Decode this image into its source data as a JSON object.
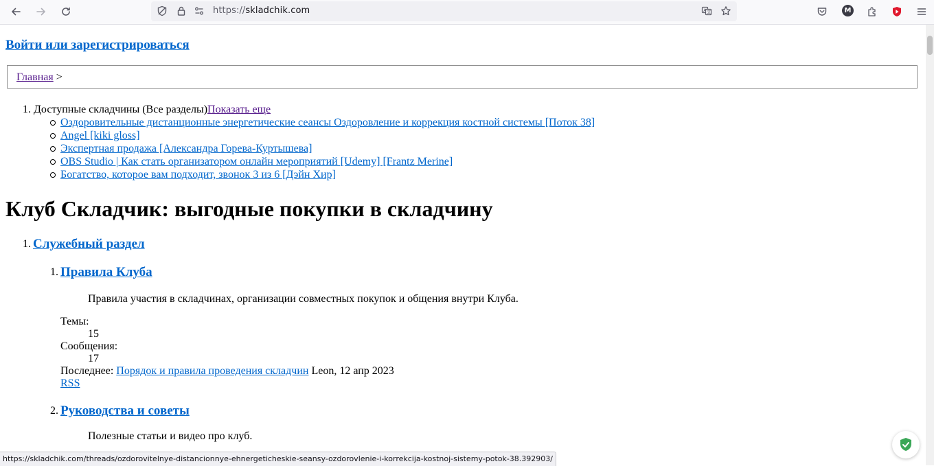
{
  "browser": {
    "url_protocol": "https://",
    "url_host": "skladchik.com",
    "avatar_letter": "M",
    "status_url": "https://skladchik.com/threads/ozdorovitelnye-distancionnye-ehnergeticheskie-seansy-ozdorovlenie-i-korrekcija-kostnoj-sistemy-potok-38.392903/"
  },
  "page": {
    "login_link": "Войти или зарегистрироваться",
    "breadcrumb": {
      "home": "Главная",
      "separator": ">"
    },
    "available": {
      "number": "1.",
      "label": "Доступные складчины (Все разделы)",
      "show_more": "Показать еще",
      "items": [
        "Оздоровительные дистанционные энергетические сеансы Оздоровление и коррекция костной системы [Поток 38]",
        "Angel [kiki gloss]",
        "Экспертная продажа [Александра Горева-Куртышева]",
        "OBS Studio | Как стать организатором онлайн мероприятий [Udemy] [Frantz Merine]",
        "Богатство, которое вам подходит, звонок 3 из 6 [Дэйн Хир]"
      ]
    },
    "title": "Клуб Складчик: выгодные покупки в складчину",
    "section": {
      "number": "1.",
      "name": "Служебный раздел",
      "forums": [
        {
          "number": "1.",
          "name": "Правила Клуба",
          "description": "Правила участия в складчинах, организации совместных покупок и общения внутри Клуба.",
          "topics_label": "Темы:",
          "topics": "15",
          "messages_label": "Сообщения:",
          "messages": "17",
          "last_label": "Последнее:",
          "last_link": "Порядок и правила проведения складчин",
          "last_meta": "Leon, 12 апр 2023",
          "rss": "RSS"
        },
        {
          "number": "2.",
          "name": "Руководства и советы",
          "description": "Полезные статьи и видео про клуб."
        }
      ]
    }
  }
}
